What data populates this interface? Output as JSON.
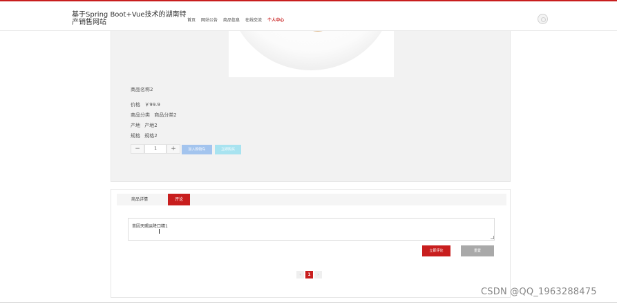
{
  "header": {
    "site_title": "基于Spring Boot+Vue技术的湖南特产销售网站",
    "nav": [
      "首页",
      "网站公告",
      "商品信息",
      "在线交流",
      "个人中心"
    ],
    "active_nav": "个人中心"
  },
  "product": {
    "name": "商品名称2",
    "price_label": "价格",
    "price_value": "￥99.9",
    "category_label": "商品分类",
    "category_value": "商品分类2",
    "origin_label": "产地",
    "origin_value": "产地2",
    "spec_label": "规格",
    "spec_value": "规格2",
    "quantity": "1",
    "minus_label": "−",
    "plus_label": "+",
    "add_cart_label": "加入购物车",
    "buy_now_label": "立即购买"
  },
  "comments": {
    "tabs": [
      "商品详情",
      "评论"
    ],
    "active_tab": "评论",
    "textarea_value": "昔因天赐运降口精1",
    "submit_label": "立即评论",
    "reset_label": "重置",
    "pagination": {
      "prev": "‹",
      "current": "1",
      "next": "›"
    }
  },
  "watermark": "CSDN @QQ_1963288475",
  "colors": {
    "accent": "#c81e1e",
    "cart_button": "#a3c4ee",
    "buy_button": "#a8e3f0",
    "reset_button": "#a9a9a9"
  }
}
